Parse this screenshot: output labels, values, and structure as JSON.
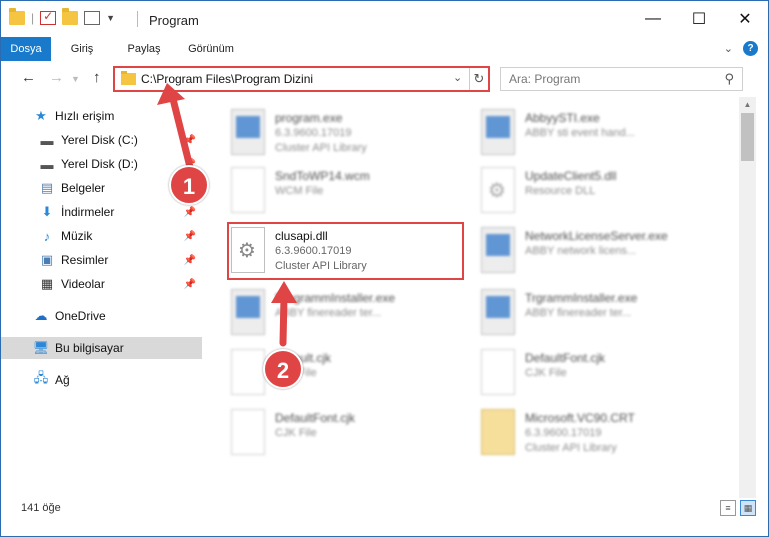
{
  "window": {
    "title": "Program",
    "controls": {
      "minimize": "—",
      "maximize": "☐",
      "close": "✕"
    }
  },
  "ribbon": {
    "tabs": [
      "Dosya",
      "Giriş",
      "Paylaş",
      "Görünüm"
    ],
    "active_tab": "Dosya",
    "accent": "#1979ca",
    "help": "?"
  },
  "address": {
    "path": "C:\\Program Files\\Program Dizini",
    "search_placeholder": "Ara: Program"
  },
  "nav": [
    {
      "label": "Hızlı erişim",
      "icon": "star-icon",
      "pinned": false
    },
    {
      "label": "Yerel Disk (C:)",
      "icon": "drive-icon",
      "pinned": true
    },
    {
      "label": "Yerel Disk (D:)",
      "icon": "drive-icon",
      "pinned": true
    },
    {
      "label": "Belgeler",
      "icon": "documents-icon",
      "pinned": true
    },
    {
      "label": "İndirmeler",
      "icon": "download-icon",
      "pinned": true
    },
    {
      "label": "Müzik",
      "icon": "music-icon",
      "pinned": true
    },
    {
      "label": "Resimler",
      "icon": "pictures-icon",
      "pinned": true
    },
    {
      "label": "Videolar",
      "icon": "video-icon",
      "pinned": true
    },
    {
      "label": "OneDrive",
      "icon": "cloud-icon",
      "pinned": false
    },
    {
      "label": "Bu bilgisayar",
      "icon": "computer-icon",
      "pinned": false
    },
    {
      "label": "Ağ",
      "icon": "network-icon",
      "pinned": false
    }
  ],
  "files": [
    {
      "name": "program.exe",
      "meta1": "6.3.9600.17019",
      "meta2": "Cluster API Library",
      "icon": "exe-icon"
    },
    {
      "name": "AbbyySTI.exe",
      "meta1": "ABBY sti event hand...",
      "meta2": "",
      "icon": "exe-icon"
    },
    {
      "name": "SndToWP14.wcm",
      "meta1": "WCM File",
      "meta2": "",
      "icon": "doc-icon"
    },
    {
      "name": "UpdateClient5.dll",
      "meta1": "Resource DLL",
      "meta2": "",
      "icon": "dll-icon"
    },
    {
      "name": "clusapi.dll",
      "meta1": "6.3.9600.17019",
      "meta2": "Cluster API Library",
      "icon": "dll-icon"
    },
    {
      "name": "NetworkLicenseServer.exe",
      "meta1": "ABBY network licens...",
      "meta2": "",
      "icon": "exe-icon"
    },
    {
      "name": "ProgrammInstaller.exe",
      "meta1": "ABBY finereader ter...",
      "meta2": "",
      "icon": "exe-icon"
    },
    {
      "name": "TrgrammInstaller.exe",
      "meta1": "ABBY finereader ter...",
      "meta2": "",
      "icon": "exe-icon"
    },
    {
      "name": "Default.cjk",
      "meta1": "CJK File",
      "meta2": "",
      "icon": "doc-icon"
    },
    {
      "name": "DefaultFont.cjk",
      "meta1": "CJK File",
      "meta2": "",
      "icon": "doc-icon"
    },
    {
      "name": "DefaultFont.cjk",
      "meta1": "CJK File",
      "meta2": "",
      "icon": "doc-icon"
    },
    {
      "name": "Microsoft.VC90.CRT",
      "meta1": "6.3.9600.17019",
      "meta2": "Cluster API Library",
      "icon": "archive-icon"
    }
  ],
  "status": {
    "count": "141 öğe"
  },
  "annotations": {
    "step1": "1",
    "step2": "2",
    "color": "#e04545"
  }
}
